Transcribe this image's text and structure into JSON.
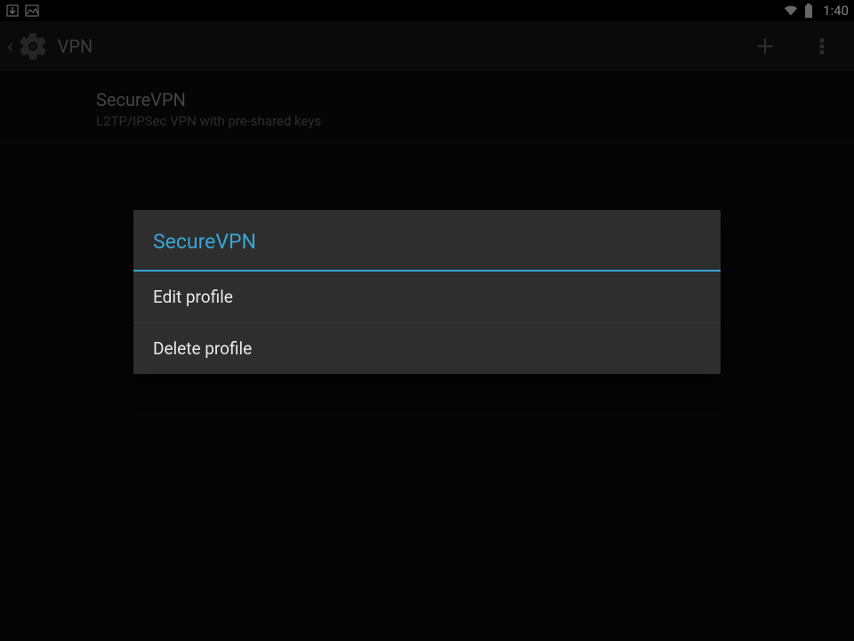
{
  "status": {
    "time": "1:40"
  },
  "actionbar": {
    "title": "VPN"
  },
  "vpn": {
    "name": "SecureVPN",
    "desc": "L2TP/IPSec VPN with pre-shared keys"
  },
  "dialog": {
    "title": "SecureVPN",
    "items": {
      "edit": "Edit profile",
      "delete": "Delete profile"
    }
  }
}
